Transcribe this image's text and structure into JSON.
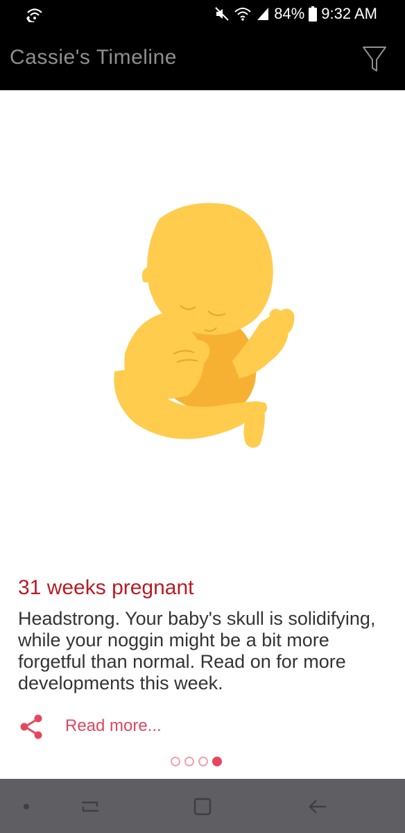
{
  "status_bar": {
    "left_icon": "wifi-call-icon",
    "icons": [
      "mute-icon",
      "wifi-icon",
      "signal-icon"
    ],
    "battery": "84%",
    "time": "9:32 AM"
  },
  "app_bar": {
    "title": "Cassie's Timeline",
    "filter_icon": "filter-icon"
  },
  "card": {
    "illustration": "fetus-illustration",
    "illustration_color": "#FFCC4D",
    "week_title": "31 weeks pregnant",
    "description": "Headstrong. Your baby's skull is solidifying, while your noggin might be a bit more forgetful than normal. Read on for more developments this week.",
    "read_more": "Read more...",
    "share_icon": "share-icon",
    "page_count": 4,
    "current_page": 4,
    "accent_color": "#E8465E",
    "title_color": "#B71C24"
  },
  "nav_bar": {
    "items": [
      "dot-icon",
      "recent-apps-icon",
      "home-icon",
      "back-icon"
    ]
  }
}
